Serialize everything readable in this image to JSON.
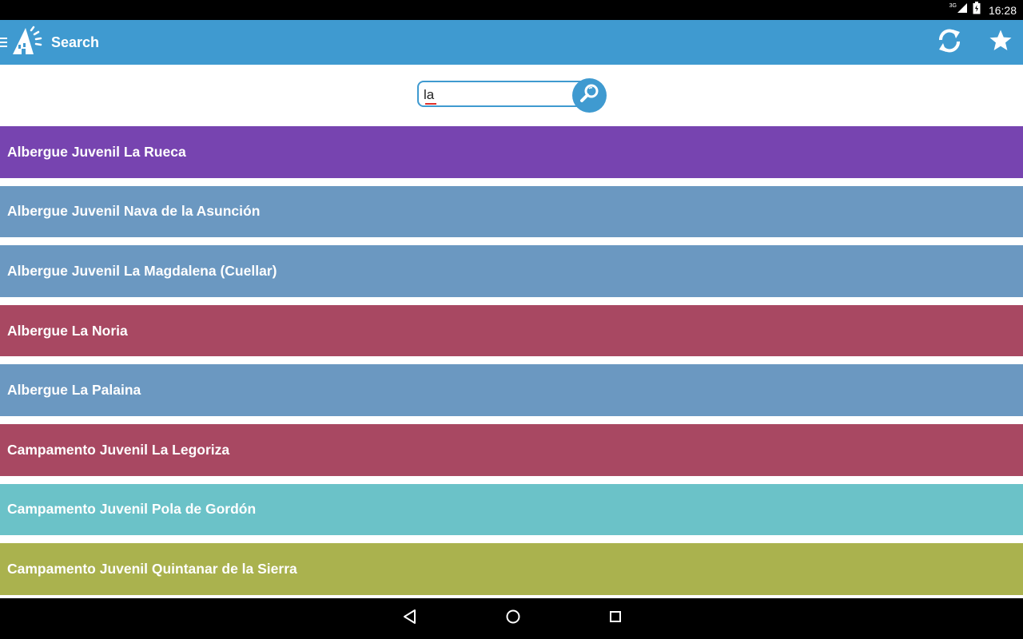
{
  "status_bar": {
    "network": "3G",
    "time": "16:28"
  },
  "app_bar": {
    "title": "Search",
    "brand_color": "#3f9ad0"
  },
  "search": {
    "value": "la",
    "placeholder": ""
  },
  "results": [
    {
      "label": "Albergue Juvenil La Rueca",
      "color": "#7744b0"
    },
    {
      "label": "Albergue Juvenil Nava de la Asunción",
      "color": "#6b98c1"
    },
    {
      "label": "Albergue Juvenil La Magdalena (Cuellar)",
      "color": "#6b98c1"
    },
    {
      "label": "Albergue La Noria",
      "color": "#a84862"
    },
    {
      "label": "Albergue La Palaina",
      "color": "#6b98c1"
    },
    {
      "label": "Campamento Juvenil La Legoriza",
      "color": "#a84862"
    },
    {
      "label": "Campamento Juvenil Pola de Gordón",
      "color": "#6bc2c8"
    },
    {
      "label": "Campamento Juvenil Quintanar de la Sierra",
      "color": "#aab24e"
    }
  ],
  "icons": {
    "menu": "menu-icon",
    "logo": "logo-icon",
    "refresh": "refresh-icon",
    "favorite": "star-icon",
    "search": "search-icon",
    "back": "back-icon",
    "home": "home-icon",
    "recents": "recents-icon"
  }
}
